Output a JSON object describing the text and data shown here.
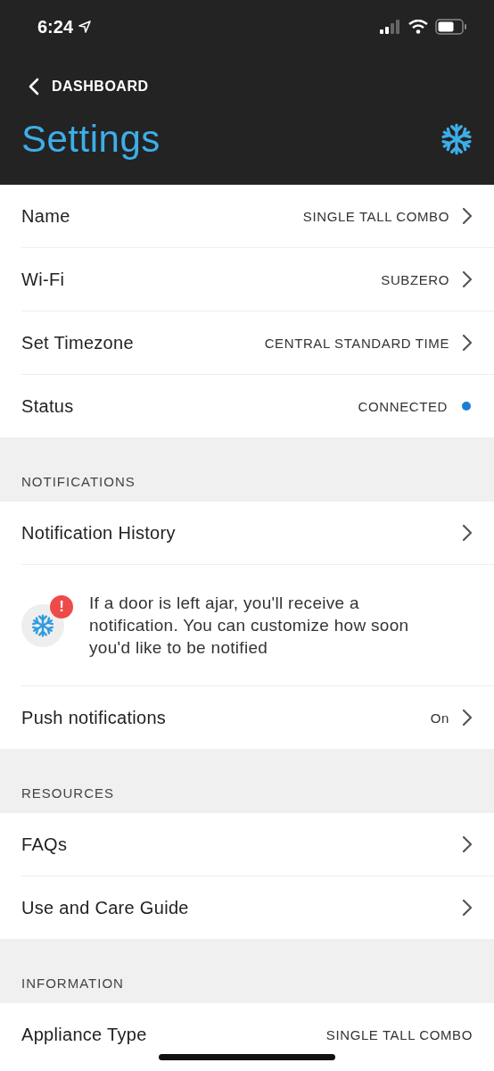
{
  "status_bar": {
    "time": "6:24"
  },
  "nav": {
    "back_label": "DASHBOARD",
    "title": "Settings"
  },
  "sections": [
    {
      "rows": [
        {
          "kind": "link",
          "label": "Name",
          "value": "SINGLE TALL COMBO"
        },
        {
          "kind": "link",
          "label": "Wi-Fi",
          "value": "SUBZERO"
        },
        {
          "kind": "link",
          "label": "Set Timezone",
          "value": "CENTRAL STANDARD TIME"
        },
        {
          "kind": "status",
          "label": "Status",
          "value": "CONNECTED",
          "color": "#1a7fd4"
        }
      ]
    },
    {
      "header": "NOTIFICATIONS",
      "rows": [
        {
          "kind": "link",
          "label": "Notification History"
        },
        {
          "kind": "info",
          "text": "If a door is left ajar, you'll receive a notification. You can customize how soon you'd like to be notified",
          "badge": "!"
        },
        {
          "kind": "link",
          "label": "Push notifications",
          "value": "On"
        }
      ]
    },
    {
      "header": "RESOURCES",
      "rows": [
        {
          "kind": "link",
          "label": "FAQs"
        },
        {
          "kind": "link",
          "label": "Use and Care Guide"
        }
      ]
    },
    {
      "header": "INFORMATION",
      "rows": [
        {
          "kind": "plain",
          "label": "Appliance Type",
          "value": "SINGLE TALL COMBO"
        }
      ]
    }
  ]
}
